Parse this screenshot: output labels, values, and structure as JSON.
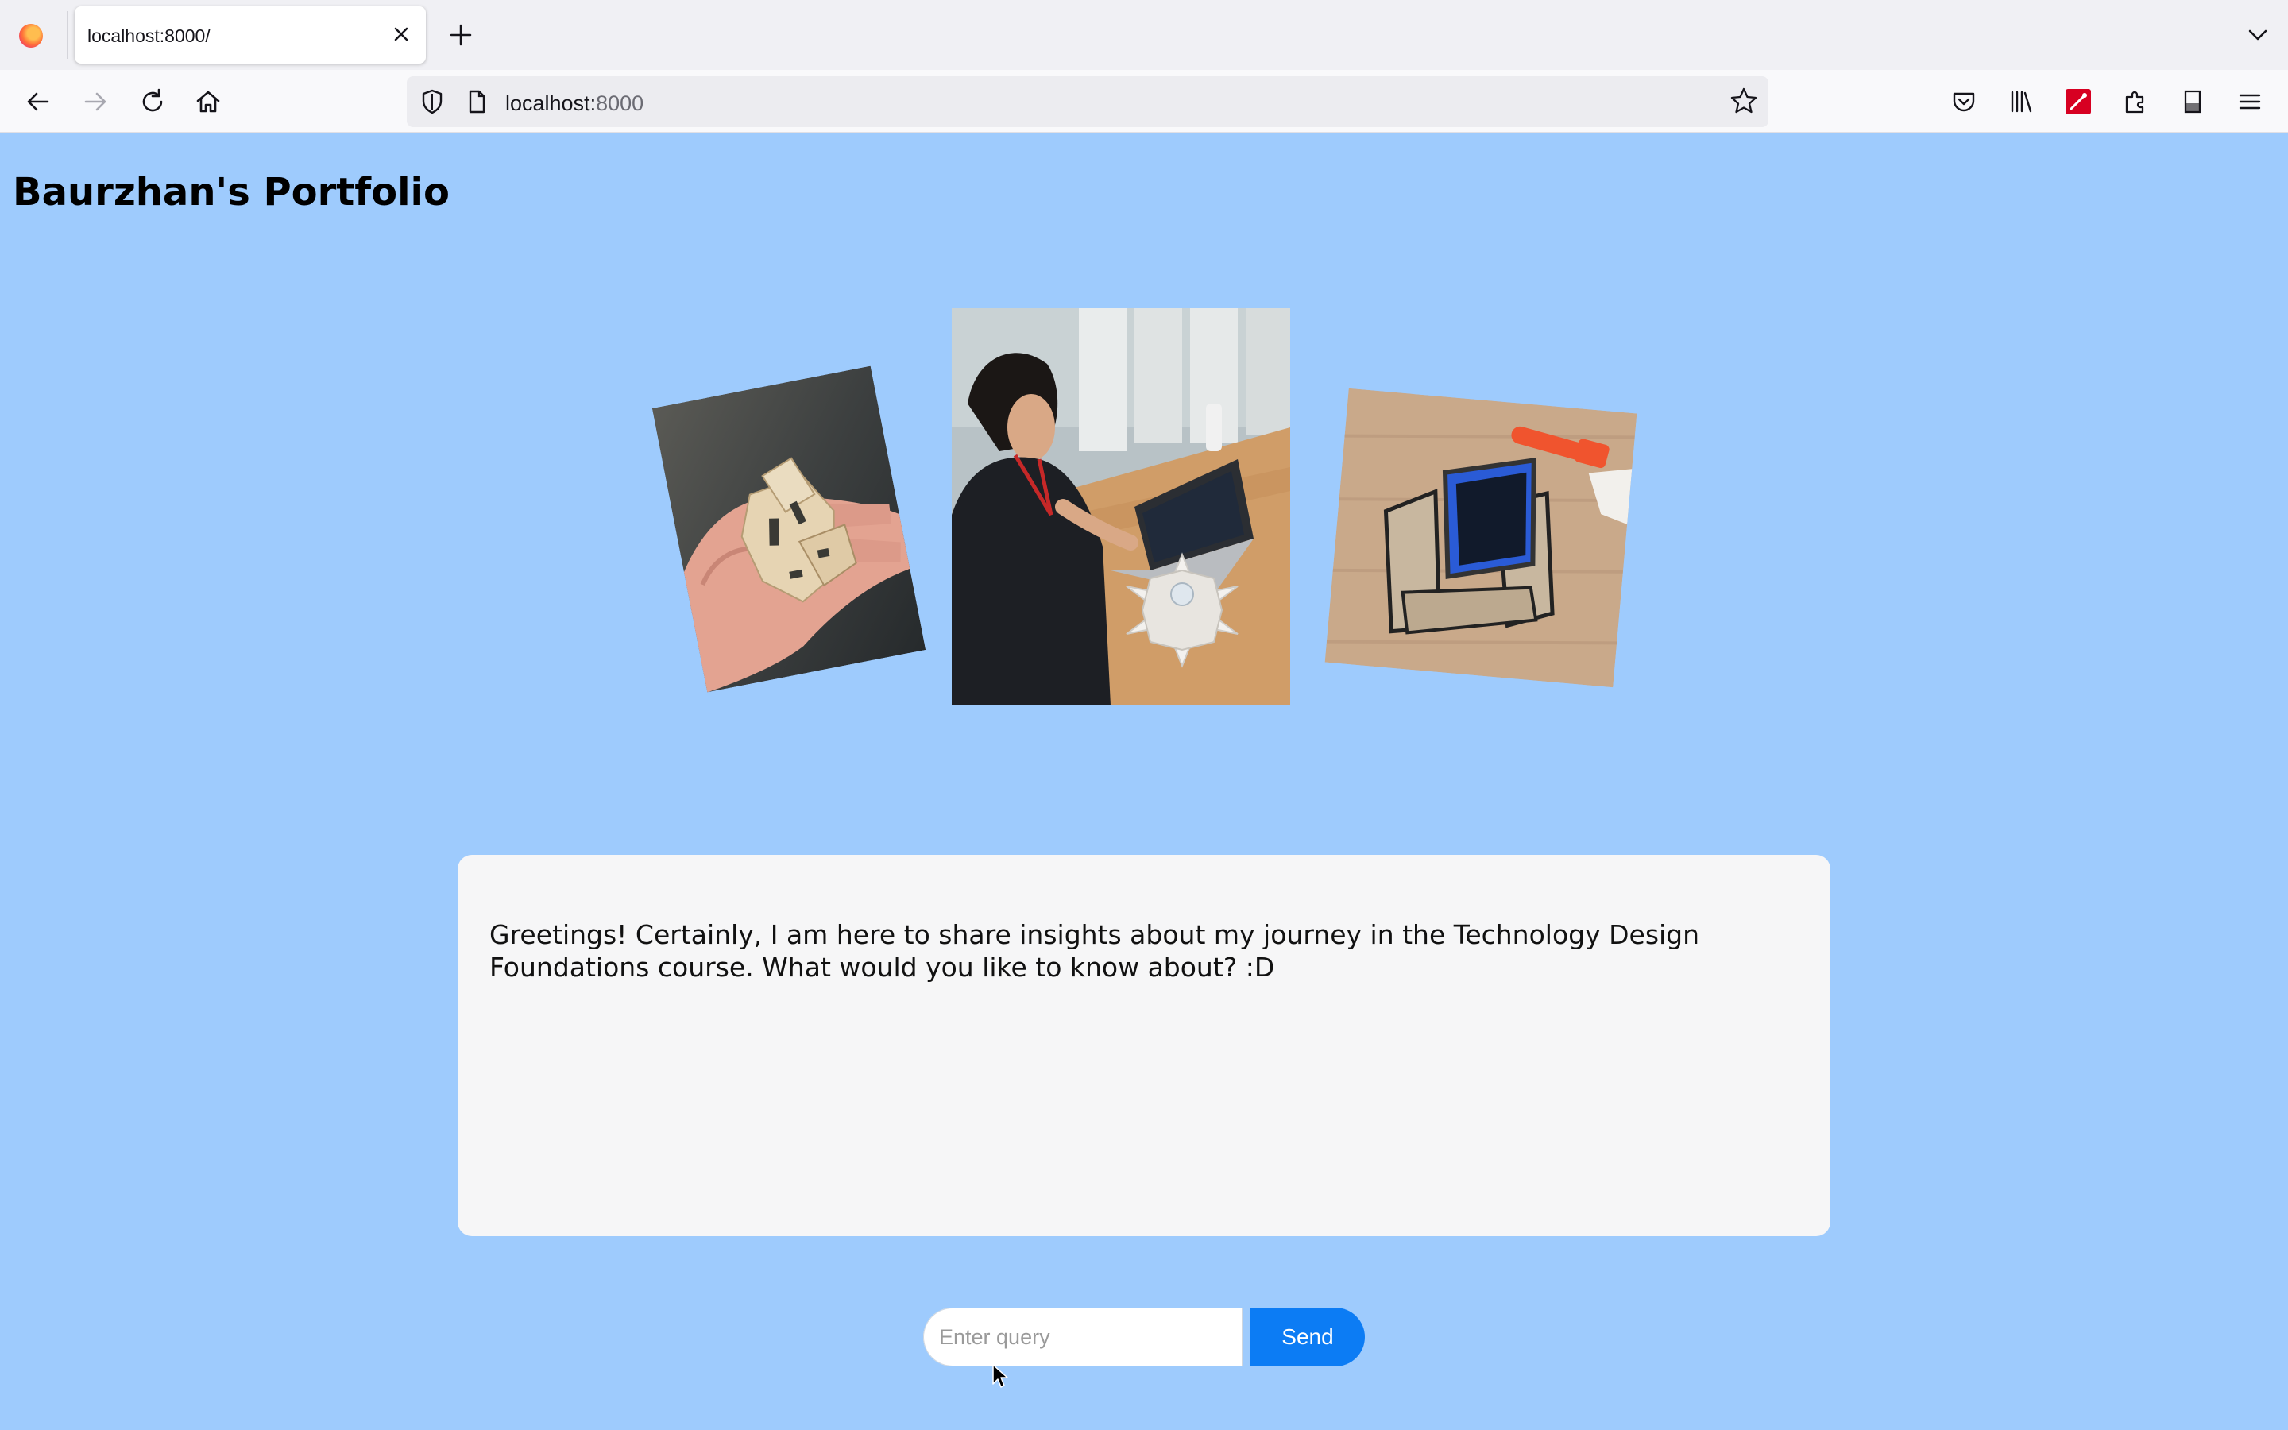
{
  "browser": {
    "tab_title": "localhost:8000/",
    "url_host": "localhost:",
    "url_port": "8000"
  },
  "page": {
    "heading": "Baurzhan's Portfolio",
    "photos": [
      {
        "name": "wooden-puzzle-in-hand-photo"
      },
      {
        "name": "student-with-paper-lamp-photo"
      },
      {
        "name": "phone-stand-photo"
      }
    ]
  },
  "chat": {
    "message": "Greetings! Certainly, I am here to share insights about my journey in the Technology Design Foundations course. What would you like to know about? :D"
  },
  "query": {
    "placeholder": "Enter query",
    "value": "",
    "send_label": "Send"
  },
  "colors": {
    "page_background": "#9ecbfd",
    "chat_background": "#f6f6f7",
    "send_button": "#0c7cf4"
  }
}
